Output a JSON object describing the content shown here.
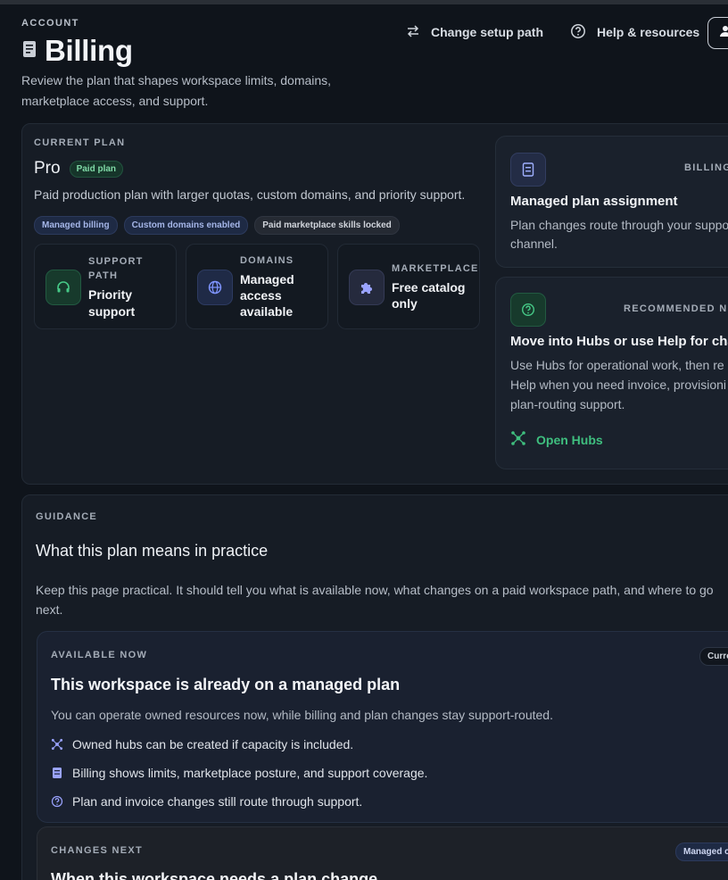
{
  "header": {
    "eyebrow": "ACCOUNT",
    "title": "Billing",
    "subtitle": "Review the plan that shapes workspace limits, domains, marketplace access, and support.",
    "actions": {
      "change_setup": "Change setup path",
      "help": "Help & resources"
    }
  },
  "plan": {
    "label": "CURRENT PLAN",
    "name": "Pro",
    "badge": "Paid plan",
    "description": "Paid production plan with larger quotas, custom domains, and priority support.",
    "tags": [
      "Managed billing",
      "Custom domains enabled",
      "Paid marketplace skills locked"
    ],
    "stats": [
      {
        "key_line1": "SUPPORT",
        "key_line2": "PATH",
        "value_line1": "Priority",
        "value_line2": "support",
        "icon": "headset-icon"
      },
      {
        "key_line1": "DOMAINS",
        "value_line1": "Managed",
        "value_line2": "access",
        "value_line3": "available",
        "icon": "globe-icon"
      },
      {
        "key_line1": "MARKETPLACE",
        "value_line1": "Free catalog",
        "value_line2": "only",
        "icon": "puzzle-icon"
      }
    ]
  },
  "side_cards": {
    "billing": {
      "tag": "BILLING",
      "title": "Managed plan assignment",
      "body_line1": "Plan changes route through your suppo",
      "body_line2": "channel."
    },
    "recommended": {
      "tag": "RECOMMENDED NEX",
      "title": "Move into Hubs or use Help for chan",
      "body_line1": "Use Hubs for operational work, then re",
      "body_line2": "Help when you need invoice, provisioni",
      "body_line3": "plan-routing support.",
      "link": "Open Hubs"
    }
  },
  "guidance": {
    "label": "GUIDANCE",
    "title": "What this plan means in practice",
    "description": "Keep this page practical. It should tell you what is available now, what changes on a paid workspace path, and where to go next.",
    "available": {
      "label": "AVAILABLE NOW",
      "pill": "Curre",
      "title": "This workspace is already on a managed plan",
      "description": "You can operate owned resources now, while billing and plan changes stay support-routed.",
      "bullets": [
        "Owned hubs can be created if capacity is included.",
        "Billing shows limits, marketplace posture, and support coverage.",
        "Plan and invoice changes still route through support."
      ]
    },
    "changes": {
      "label": "CHANGES NEXT",
      "pill": "Managed cl",
      "title": "When this workspace needs a plan change"
    }
  },
  "colors": {
    "background": "#0f141b",
    "panel": "#161c25",
    "accent_green": "#3fbf7f",
    "accent_indigo": "#8f9bff"
  }
}
